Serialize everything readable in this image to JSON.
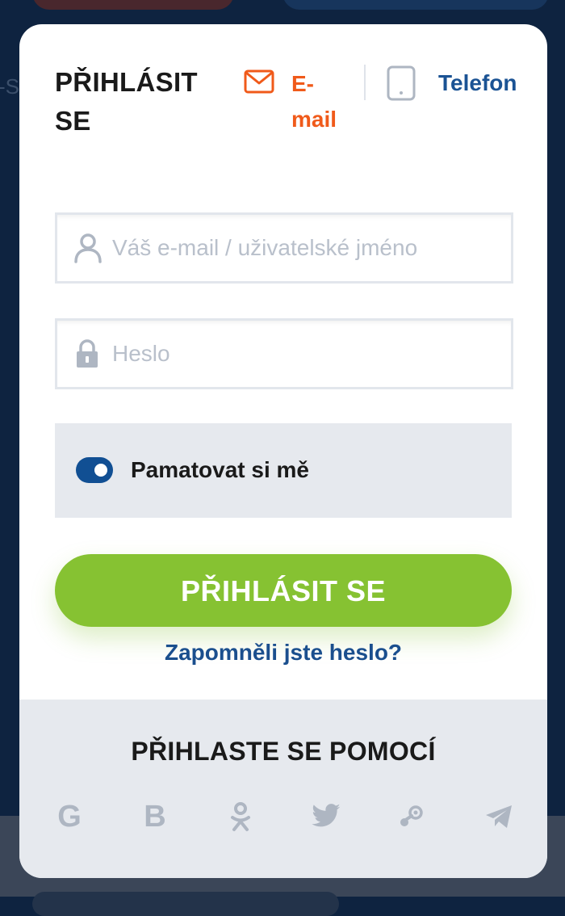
{
  "background": {
    "fragment_text": "-S"
  },
  "header": {
    "title": "PŘIHLÁSIT SE",
    "tabs": [
      {
        "label": "E-mail",
        "icon": "envelope-icon",
        "active": true,
        "color": "#f05a1a"
      },
      {
        "label": "Telefon",
        "icon": "phone-icon",
        "active": false,
        "color": "#1b5394"
      }
    ]
  },
  "form": {
    "email_placeholder": "Váš e-mail / uživatelské jméno",
    "email_value": "",
    "password_placeholder": "Heslo",
    "password_value": "",
    "remember_label": "Pamatovat si mě",
    "remember_checked": true,
    "submit_label": "PŘIHLÁSIT SE",
    "forgot_label": "Zapomněli jste heslo?"
  },
  "social": {
    "heading": "PŘIHLASTE SE POMOCÍ",
    "providers": [
      {
        "name": "google",
        "icon": "google-icon",
        "glyph": "G"
      },
      {
        "name": "vk",
        "icon": "vk-icon",
        "glyph": "B"
      },
      {
        "name": "odnoklassniki",
        "icon": "odnoklassniki-icon"
      },
      {
        "name": "twitter",
        "icon": "twitter-icon"
      },
      {
        "name": "steam",
        "icon": "steam-icon"
      },
      {
        "name": "telegram",
        "icon": "telegram-icon"
      }
    ]
  },
  "colors": {
    "accent_orange": "#f05a1a",
    "brand_blue": "#1b5394",
    "button_green": "#86c232",
    "panel_gray": "#e6e9ee",
    "icon_gray": "#aeb6c2"
  }
}
